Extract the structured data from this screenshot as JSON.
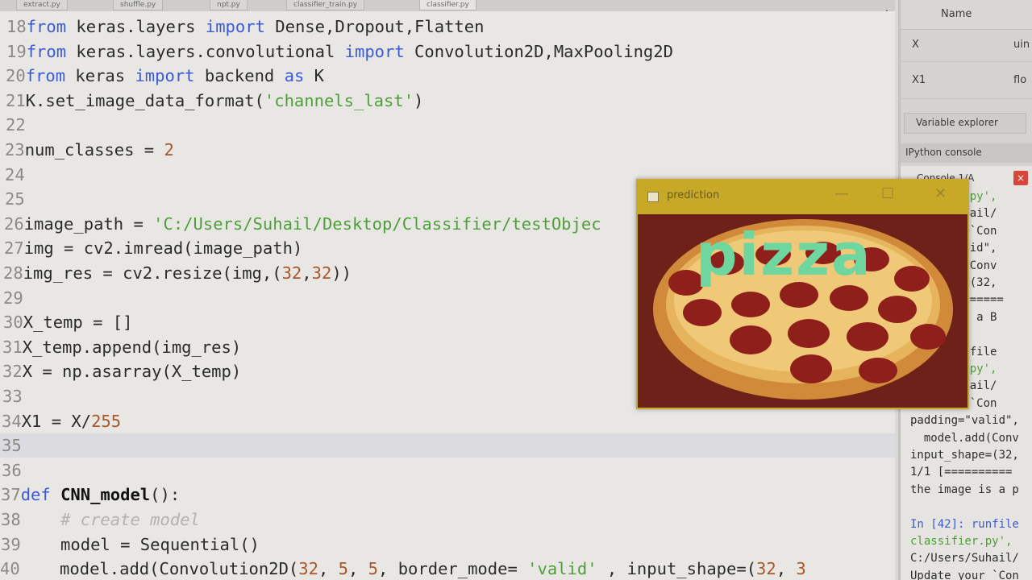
{
  "tabs": [
    "extract.py",
    "shuffle.py",
    "npt.py",
    "classifier_train.py",
    "classifier.py"
  ],
  "active_tab": 4,
  "editor": {
    "lines": [
      {
        "n": "18",
        "tokens": [
          {
            "t": "from",
            "c": "kw"
          },
          {
            "t": " keras.layers ",
            "c": ""
          },
          {
            "t": "import",
            "c": "kw"
          },
          {
            "t": " Dense,Dropout,Flatten",
            "c": ""
          }
        ]
      },
      {
        "n": "19",
        "tokens": [
          {
            "t": "from",
            "c": "kw"
          },
          {
            "t": " keras.layers.convolutional ",
            "c": ""
          },
          {
            "t": "import",
            "c": "kw"
          },
          {
            "t": " Convolution2D,MaxPooling2D",
            "c": ""
          }
        ]
      },
      {
        "n": "20",
        "tokens": [
          {
            "t": "from",
            "c": "kw"
          },
          {
            "t": " keras ",
            "c": ""
          },
          {
            "t": "import",
            "c": "kw"
          },
          {
            "t": " backend ",
            "c": ""
          },
          {
            "t": "as",
            "c": "kw"
          },
          {
            "t": " K",
            "c": ""
          }
        ]
      },
      {
        "n": "21",
        "tokens": [
          {
            "t": "K.set_image_data_format(",
            "c": ""
          },
          {
            "t": "'channels_last'",
            "c": "str"
          },
          {
            "t": ")",
            "c": ""
          }
        ]
      },
      {
        "n": "22",
        "tokens": []
      },
      {
        "n": "23",
        "tokens": [
          {
            "t": "num_classes = ",
            "c": ""
          },
          {
            "t": "2",
            "c": "num"
          }
        ]
      },
      {
        "n": "24",
        "tokens": []
      },
      {
        "n": "25",
        "tokens": []
      },
      {
        "n": "26",
        "tokens": [
          {
            "t": "image_path = ",
            "c": ""
          },
          {
            "t": "'C:/Users/Suhail/Desktop/Classifier/testObjec",
            "c": "str"
          }
        ]
      },
      {
        "n": "27",
        "tokens": [
          {
            "t": "img = cv2.imread(image_path)",
            "c": ""
          }
        ]
      },
      {
        "n": "28",
        "tokens": [
          {
            "t": "img_res = cv2.resize(img,(",
            "c": ""
          },
          {
            "t": "32",
            "c": "num"
          },
          {
            "t": ",",
            "c": ""
          },
          {
            "t": "32",
            "c": "num"
          },
          {
            "t": "))",
            "c": ""
          }
        ]
      },
      {
        "n": "29",
        "tokens": []
      },
      {
        "n": "30",
        "tokens": [
          {
            "t": "X_temp = []",
            "c": ""
          }
        ]
      },
      {
        "n": "31",
        "tokens": [
          {
            "t": "X_temp.append(img_res)",
            "c": ""
          }
        ]
      },
      {
        "n": "32",
        "tokens": [
          {
            "t": "X = np.asarray(X_temp)",
            "c": ""
          }
        ]
      },
      {
        "n": "33",
        "tokens": []
      },
      {
        "n": "34",
        "tokens": [
          {
            "t": "X1 = X/",
            "c": ""
          },
          {
            "t": "255",
            "c": "num"
          }
        ]
      },
      {
        "n": "35",
        "tokens": [],
        "current": true
      },
      {
        "n": "36",
        "tokens": []
      },
      {
        "n": "37",
        "tokens": [
          {
            "t": "def",
            "c": "kw"
          },
          {
            "t": " ",
            "c": ""
          },
          {
            "t": "CNN_model",
            "c": "fn"
          },
          {
            "t": "():",
            "c": ""
          }
        ]
      },
      {
        "n": "38",
        "tokens": [
          {
            "t": "    ",
            "c": ""
          },
          {
            "t": "# create model",
            "c": "cmt"
          }
        ]
      },
      {
        "n": "39",
        "tokens": [
          {
            "t": "    model = Sequential()",
            "c": ""
          }
        ]
      },
      {
        "n": "40",
        "tokens": [
          {
            "t": "    model.add(Convolution2D(",
            "c": ""
          },
          {
            "t": "32",
            "c": "num"
          },
          {
            "t": ", ",
            "c": ""
          },
          {
            "t": "5",
            "c": "num"
          },
          {
            "t": ", ",
            "c": ""
          },
          {
            "t": "5",
            "c": "num"
          },
          {
            "t": ", border_mode= ",
            "c": ""
          },
          {
            "t": "'valid'",
            "c": "str"
          },
          {
            "t": " , input_shape=(",
            "c": ""
          },
          {
            "t": "32",
            "c": "num"
          },
          {
            "t": ", ",
            "c": ""
          },
          {
            "t": "3",
            "c": "num"
          }
        ]
      }
    ]
  },
  "variable_explorer": {
    "header": "Name",
    "rows": [
      {
        "name": "X",
        "type": "uin"
      },
      {
        "name": "X1",
        "type": "flo"
      }
    ],
    "tab_label": "Variable explorer"
  },
  "ipython": {
    "bar_label": "IPython console",
    "tab_label": "Console 1/A",
    "close_glyph": "×",
    "lines": [
      {
        "t": "ier.py',",
        "c": "green"
      },
      {
        "t": "/Suhail/",
        "c": ""
      },
      {
        "t": "our `Con",
        "c": ""
      },
      {
        "t": "\"valid\",",
        "c": ""
      },
      {
        "t": "add(Conv",
        "c": ""
      },
      {
        "t": "ape=(32,",
        "c": ""
      },
      {
        "t": "=========",
        "c": ""
      },
      {
        "t": "e is a B",
        "c": ""
      },
      {
        "t": "",
        "c": ""
      },
      {
        "t": " runfile",
        "c": ""
      },
      {
        "t": "ier.py',",
        "c": "green"
      },
      {
        "t": "/Suhail/",
        "c": ""
      },
      {
        "t": "our `Con",
        "c": ""
      },
      {
        "t": "padding=\"valid\",",
        "c": ""
      },
      {
        "t": "  model.add(Conv",
        "c": ""
      },
      {
        "t": "input_shape=(32,",
        "c": ""
      },
      {
        "t": "1/1 [==========",
        "c": ""
      },
      {
        "t": "the image is a p",
        "c": ""
      },
      {
        "t": "",
        "c": ""
      },
      {
        "t": "In [42]: runfile",
        "c": "blue"
      },
      {
        "t": "classifier.py',",
        "c": "green"
      },
      {
        "t": "C:/Users/Suhail/",
        "c": ""
      },
      {
        "t": "Update your `Con",
        "c": ""
      }
    ]
  },
  "prediction_window": {
    "title": "prediction",
    "minimize": "—",
    "maximize": "☐",
    "close": "✕",
    "label": "pizza"
  }
}
